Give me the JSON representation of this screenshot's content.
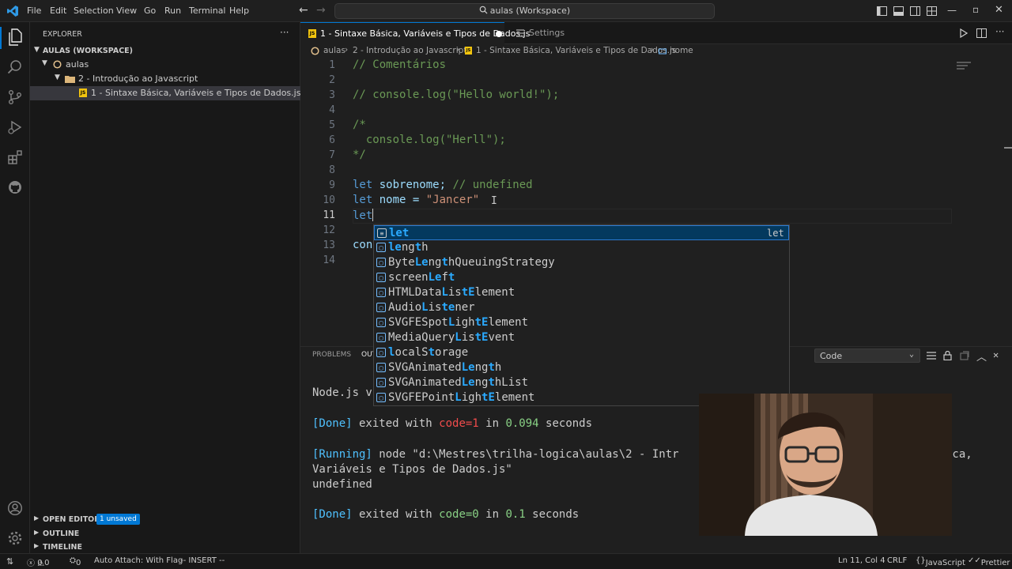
{
  "titlebar": {
    "menus": [
      "File",
      "Edit",
      "Selection",
      "View",
      "Go",
      "Run",
      "Terminal",
      "Help"
    ],
    "search_text": "aulas (Workspace)"
  },
  "sidebar": {
    "header": "EXPLORER",
    "workspace": "AULAS (WORKSPACE)",
    "tree": [
      {
        "label": "aulas"
      },
      {
        "label": "2 - Introdução ao Javascript"
      },
      {
        "label": "1 - Sintaxe Básica, Variáveis e Tipos de Dados.js"
      }
    ],
    "open_editors": "OPEN EDITORS",
    "unsaved_badge": "1 unsaved",
    "outline": "OUTLINE",
    "timeline": "TIMELINE"
  },
  "tabs": {
    "active": "1 - Sintaxe Básica, Variáveis e Tipos de Dados.js",
    "settings": "Settings"
  },
  "breadcrumb": {
    "parts": [
      "aulas",
      "2 - Introdução ao Javascript",
      "1 - Sintaxe Básica, Variáveis e Tipos de Dados.js",
      "nome"
    ]
  },
  "editor": {
    "line_numbers": [
      "1",
      "2",
      "3",
      "4",
      "5",
      "6",
      "7",
      "8",
      "9",
      "10",
      "11",
      "12",
      "13",
      "14"
    ],
    "current_line": "11",
    "lines": {
      "l1": "// Comentários",
      "l3": "// console.log(\"Hello world!\");",
      "l5": "/*",
      "l6": "  console.log(\"Herll\");",
      "l7": "*/",
      "l9_kw": "let",
      "l9_var": " sobrenome; ",
      "l9_cm": "// undefined",
      "l10_kw": "let",
      "l10_var": " nome = ",
      "l10_str": "\"Jancer\"",
      "l11_kw": "let",
      "l13": "con"
    }
  },
  "suggest": {
    "detail": "let",
    "items": [
      {
        "pre": "",
        "hl": "let",
        "post": ""
      },
      {
        "pre": "",
        "hl": "le",
        "post": "ng",
        "hl2": "t",
        "post2": "h"
      },
      {
        "pre": "Byte",
        "hl": "Le",
        "post": "ng",
        "hl2": "t",
        "post2": "hQueuingStrategy"
      },
      {
        "pre": "screen",
        "hl": "Le",
        "post": "f",
        "hl2": "t",
        "post2": ""
      },
      {
        "pre": "HTMLData",
        "hl": "L",
        "post": "is",
        "hl2": "tE",
        "post2": "lement"
      },
      {
        "pre": "Audio",
        "hl": "L",
        "post": "is",
        "hl2": "te",
        "post2": "ner"
      },
      {
        "pre": "SVGFESpot",
        "hl": "L",
        "post": "igh",
        "hl2": "tE",
        "post2": "lement"
      },
      {
        "pre": "MediaQuery",
        "hl": "L",
        "post": "is",
        "hl2": "tE",
        "post2": "vent"
      },
      {
        "pre": "",
        "hl": "l",
        "post": "ocalS",
        "hl2": "t",
        "post2": "orage"
      },
      {
        "pre": "SVGAnimated",
        "hl": "Le",
        "post": "ng",
        "hl2": "t",
        "post2": "h"
      },
      {
        "pre": "SVGAnimated",
        "hl": "Le",
        "post": "ng",
        "hl2": "t",
        "post2": "hList"
      },
      {
        "pre": "SVGFEPoint",
        "hl": "L",
        "post": "igh",
        "hl2": "tE",
        "post2": "lement"
      }
    ]
  },
  "panel": {
    "tabs": [
      "PROBLEMS",
      "OUTPUT"
    ],
    "channel": "Code",
    "partial_line": "Node.js v",
    "done1_a": "[Done]",
    "done1_b": " exited with ",
    "done1_code": "code=1",
    "done1_c": " in ",
    "done1_time": "0.094",
    "done1_d": " seconds",
    "running_a": "[Running]",
    "running_b": " node \"d:\\Mestres\\trilha-logica\\aulas\\2 - Intr",
    "running_c": "ica,",
    "running_line2": "Variáveis e Tipos de Dados.js\"",
    "undefined": "undefined",
    "done2_a": "[Done]",
    "done2_b": " exited with ",
    "done2_code": "code=0",
    "done2_c": " in ",
    "done2_time": "0.1",
    "done2_d": " seconds"
  },
  "statusbar": {
    "errors": "0",
    "warnings": "0",
    "ports": "0",
    "auto_attach": "Auto Attach: With Flag",
    "mode": "-- INSERT --",
    "position": "Ln 11, Col 4",
    "eol": "CRLF",
    "language": "JavaScript",
    "formatter": "Prettier"
  }
}
